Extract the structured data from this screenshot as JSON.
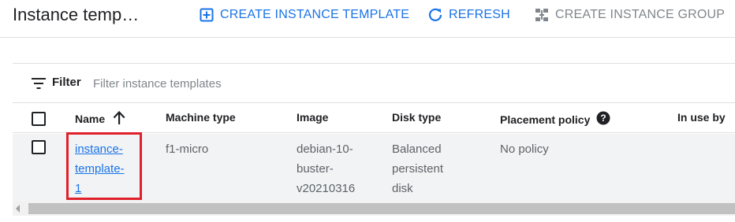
{
  "header": {
    "title": "Instance temp…",
    "actions": [
      {
        "label": "CREATE INSTANCE TEMPLATE",
        "icon": "add-box-icon",
        "color": "#1a73e8"
      },
      {
        "label": "REFRESH",
        "icon": "refresh-icon",
        "color": "#1a73e8"
      },
      {
        "label": "CREATE INSTANCE GROUP",
        "icon": "instance-group-icon",
        "color": "#80868b"
      }
    ]
  },
  "filter": {
    "label": "Filter",
    "placeholder": "Filter instance templates",
    "icon": "filter-icon"
  },
  "table": {
    "columns": [
      {
        "label": "Name",
        "sort": "ascending",
        "icon": "sort-arrow-up-icon"
      },
      {
        "label": "Machine type"
      },
      {
        "label": "Image"
      },
      {
        "label": "Disk type"
      },
      {
        "label": "Placement policy",
        "icon": "help-icon"
      },
      {
        "label": "In use by"
      }
    ],
    "rows": [
      {
        "selected": false,
        "name_lines": [
          "instance-",
          "template-",
          "1"
        ],
        "machine_type": "f1-micro",
        "image_lines": [
          "debian-10-",
          "buster-",
          "v20210316"
        ],
        "disk_type_lines": [
          "Balanced",
          "persistent",
          "disk"
        ],
        "placement_policy": "No policy",
        "in_use_by": ""
      }
    ]
  },
  "colors": {
    "accent": "#1a73e8",
    "disabled": "#80868b",
    "highlight_box": "#e0202a",
    "row_background": "#f1f3f4"
  }
}
